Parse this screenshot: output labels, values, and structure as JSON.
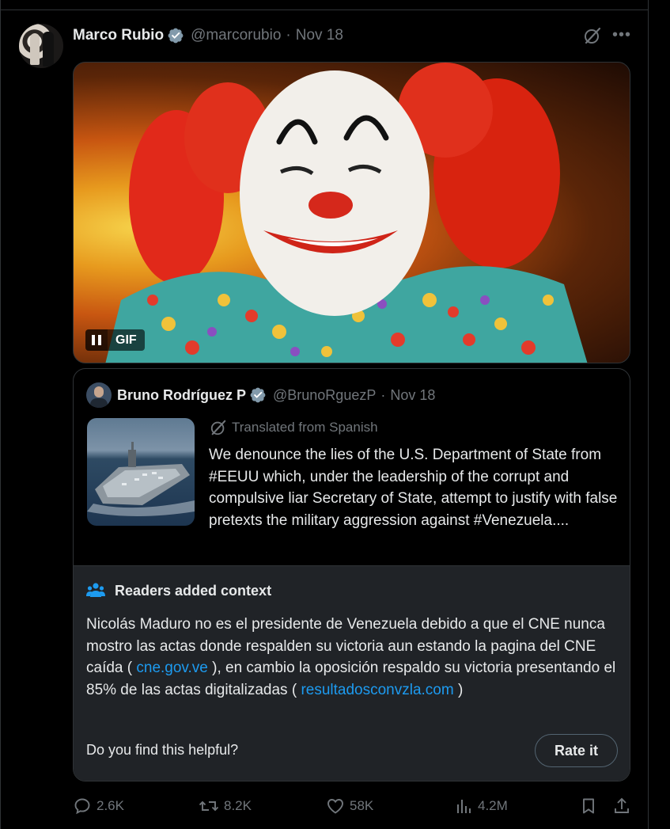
{
  "post": {
    "author_name": "Marco Rubio",
    "author_handle": "@marcorubio",
    "separator": "·",
    "date": "Nov 18",
    "more_glyph": "•••",
    "media": {
      "badge_label": "GIF",
      "icon": "pause-icon"
    }
  },
  "quoted_post": {
    "author_name": "Bruno Rodríguez P",
    "author_handle": "@BrunoRguezP",
    "separator": "·",
    "date": "Nov 18",
    "translated_label": "Translated from Spanish",
    "text": "We denounce the lies of the U.S. Department of State from #EEUU which, under the leadership of the corrupt and compulsive liar Secretary of State, attempt to justify with false pretexts the military aggression against #Venezuela...."
  },
  "community_note": {
    "title": "Readers added context",
    "body_part1": "Nicolás Maduro no es el presidente de Venezuela debido a que el CNE nunca mostro las actas donde respalden su victoria aun estando la pagina del CNE caída ( ",
    "link1": "cne.gov.ve",
    "body_part2": " ), en cambio la oposición respaldo su victoria presentando el 85% de las actas digitalizadas ( ",
    "link2": "resultadosconvzla.com",
    "body_part3": " )",
    "helpful_question": "Do you find this helpful?",
    "rate_button": "Rate it"
  },
  "actions": {
    "replies": "2.6K",
    "reposts": "8.2K",
    "likes": "58K",
    "views": "4.2M"
  },
  "colors": {
    "background": "#000000",
    "text": "#e7e9ea",
    "muted": "#71767b",
    "link": "#1d9bf0",
    "verified": "#829aab",
    "note_background": "#202327"
  }
}
